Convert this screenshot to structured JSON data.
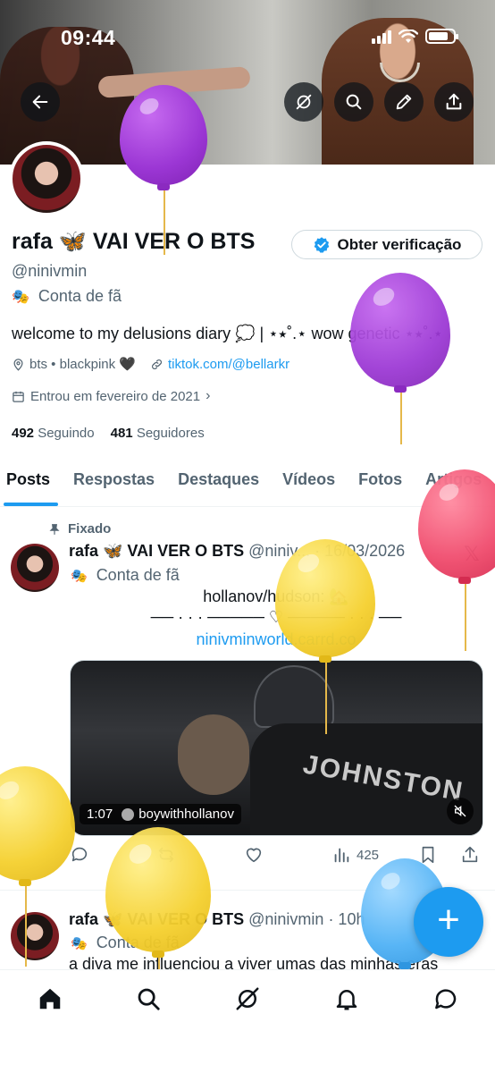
{
  "status_bar": {
    "time": "09:44"
  },
  "profile": {
    "name": "rafa 🦋 VAI VER O BTS",
    "verify_label": "Obter verificação",
    "handle": "@ninivmin",
    "category": "Conta de fã",
    "bio": "welcome to my delusions diary 💭 | ⋆⭑˚.⋆ wow genetic ⋆⭑˚.⋆",
    "location": "bts • blackpink 🖤",
    "link": "tiktok.com/@bellarkr",
    "joined": "Entrou em fevereiro de 2021",
    "following_count": "492",
    "following_label": "Seguindo",
    "followers_count": "481",
    "followers_label": "Seguidores"
  },
  "tabs": [
    "Posts",
    "Respostas",
    "Destaques",
    "Vídeos",
    "Fotos",
    "Artigos"
  ],
  "pinned_post": {
    "pinned_label": "Fixado",
    "name": "rafa 🦋 VAI VER O BTS",
    "handle_date": "@niniv... · 16/03/2026",
    "category": "Conta de fã",
    "line1": "hollanov/hudson: 🏡",
    "line2": "── · · · ───── ♡ ───── · · · ──",
    "link": "ninivminworld.carrd.co",
    "video_duration": "1:07",
    "video_author": "boywithhollanov",
    "views": "425"
  },
  "second_post": {
    "name": "rafa 🦋 VAI VER O BTS",
    "handle_time": "@ninivmin · 10h",
    "category": "Conta de fã",
    "text": "a diva me influenciou a viver umas das minhas eras"
  },
  "colors": {
    "accent": "#1d9bf0",
    "text": "#0f1419",
    "muted": "#536471"
  },
  "icons": [
    "back-icon",
    "grok-icon",
    "search-icon",
    "edit-icon",
    "share-icon",
    "home-icon",
    "explore-icon",
    "notifications-icon",
    "messages-icon"
  ]
}
